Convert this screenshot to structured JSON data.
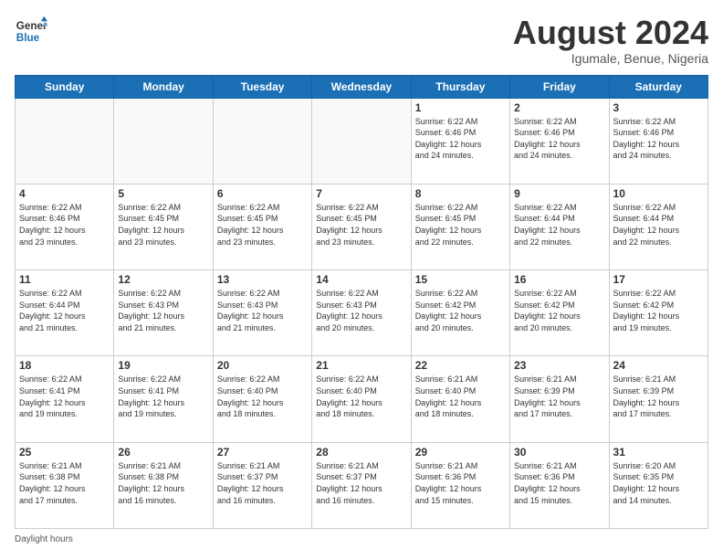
{
  "header": {
    "logo_line1": "General",
    "logo_line2": "Blue",
    "month": "August 2024",
    "location": "Igumale, Benue, Nigeria"
  },
  "days_of_week": [
    "Sunday",
    "Monday",
    "Tuesday",
    "Wednesday",
    "Thursday",
    "Friday",
    "Saturday"
  ],
  "weeks": [
    [
      {
        "day": "",
        "info": ""
      },
      {
        "day": "",
        "info": ""
      },
      {
        "day": "",
        "info": ""
      },
      {
        "day": "",
        "info": ""
      },
      {
        "day": "1",
        "info": "Sunrise: 6:22 AM\nSunset: 6:46 PM\nDaylight: 12 hours\nand 24 minutes."
      },
      {
        "day": "2",
        "info": "Sunrise: 6:22 AM\nSunset: 6:46 PM\nDaylight: 12 hours\nand 24 minutes."
      },
      {
        "day": "3",
        "info": "Sunrise: 6:22 AM\nSunset: 6:46 PM\nDaylight: 12 hours\nand 24 minutes."
      }
    ],
    [
      {
        "day": "4",
        "info": "Sunrise: 6:22 AM\nSunset: 6:46 PM\nDaylight: 12 hours\nand 23 minutes."
      },
      {
        "day": "5",
        "info": "Sunrise: 6:22 AM\nSunset: 6:45 PM\nDaylight: 12 hours\nand 23 minutes."
      },
      {
        "day": "6",
        "info": "Sunrise: 6:22 AM\nSunset: 6:45 PM\nDaylight: 12 hours\nand 23 minutes."
      },
      {
        "day": "7",
        "info": "Sunrise: 6:22 AM\nSunset: 6:45 PM\nDaylight: 12 hours\nand 23 minutes."
      },
      {
        "day": "8",
        "info": "Sunrise: 6:22 AM\nSunset: 6:45 PM\nDaylight: 12 hours\nand 22 minutes."
      },
      {
        "day": "9",
        "info": "Sunrise: 6:22 AM\nSunset: 6:44 PM\nDaylight: 12 hours\nand 22 minutes."
      },
      {
        "day": "10",
        "info": "Sunrise: 6:22 AM\nSunset: 6:44 PM\nDaylight: 12 hours\nand 22 minutes."
      }
    ],
    [
      {
        "day": "11",
        "info": "Sunrise: 6:22 AM\nSunset: 6:44 PM\nDaylight: 12 hours\nand 21 minutes."
      },
      {
        "day": "12",
        "info": "Sunrise: 6:22 AM\nSunset: 6:43 PM\nDaylight: 12 hours\nand 21 minutes."
      },
      {
        "day": "13",
        "info": "Sunrise: 6:22 AM\nSunset: 6:43 PM\nDaylight: 12 hours\nand 21 minutes."
      },
      {
        "day": "14",
        "info": "Sunrise: 6:22 AM\nSunset: 6:43 PM\nDaylight: 12 hours\nand 20 minutes."
      },
      {
        "day": "15",
        "info": "Sunrise: 6:22 AM\nSunset: 6:42 PM\nDaylight: 12 hours\nand 20 minutes."
      },
      {
        "day": "16",
        "info": "Sunrise: 6:22 AM\nSunset: 6:42 PM\nDaylight: 12 hours\nand 20 minutes."
      },
      {
        "day": "17",
        "info": "Sunrise: 6:22 AM\nSunset: 6:42 PM\nDaylight: 12 hours\nand 19 minutes."
      }
    ],
    [
      {
        "day": "18",
        "info": "Sunrise: 6:22 AM\nSunset: 6:41 PM\nDaylight: 12 hours\nand 19 minutes."
      },
      {
        "day": "19",
        "info": "Sunrise: 6:22 AM\nSunset: 6:41 PM\nDaylight: 12 hours\nand 19 minutes."
      },
      {
        "day": "20",
        "info": "Sunrise: 6:22 AM\nSunset: 6:40 PM\nDaylight: 12 hours\nand 18 minutes."
      },
      {
        "day": "21",
        "info": "Sunrise: 6:22 AM\nSunset: 6:40 PM\nDaylight: 12 hours\nand 18 minutes."
      },
      {
        "day": "22",
        "info": "Sunrise: 6:21 AM\nSunset: 6:40 PM\nDaylight: 12 hours\nand 18 minutes."
      },
      {
        "day": "23",
        "info": "Sunrise: 6:21 AM\nSunset: 6:39 PM\nDaylight: 12 hours\nand 17 minutes."
      },
      {
        "day": "24",
        "info": "Sunrise: 6:21 AM\nSunset: 6:39 PM\nDaylight: 12 hours\nand 17 minutes."
      }
    ],
    [
      {
        "day": "25",
        "info": "Sunrise: 6:21 AM\nSunset: 6:38 PM\nDaylight: 12 hours\nand 17 minutes."
      },
      {
        "day": "26",
        "info": "Sunrise: 6:21 AM\nSunset: 6:38 PM\nDaylight: 12 hours\nand 16 minutes."
      },
      {
        "day": "27",
        "info": "Sunrise: 6:21 AM\nSunset: 6:37 PM\nDaylight: 12 hours\nand 16 minutes."
      },
      {
        "day": "28",
        "info": "Sunrise: 6:21 AM\nSunset: 6:37 PM\nDaylight: 12 hours\nand 16 minutes."
      },
      {
        "day": "29",
        "info": "Sunrise: 6:21 AM\nSunset: 6:36 PM\nDaylight: 12 hours\nand 15 minutes."
      },
      {
        "day": "30",
        "info": "Sunrise: 6:21 AM\nSunset: 6:36 PM\nDaylight: 12 hours\nand 15 minutes."
      },
      {
        "day": "31",
        "info": "Sunrise: 6:20 AM\nSunset: 6:35 PM\nDaylight: 12 hours\nand 14 minutes."
      }
    ]
  ],
  "footer": "Daylight hours"
}
